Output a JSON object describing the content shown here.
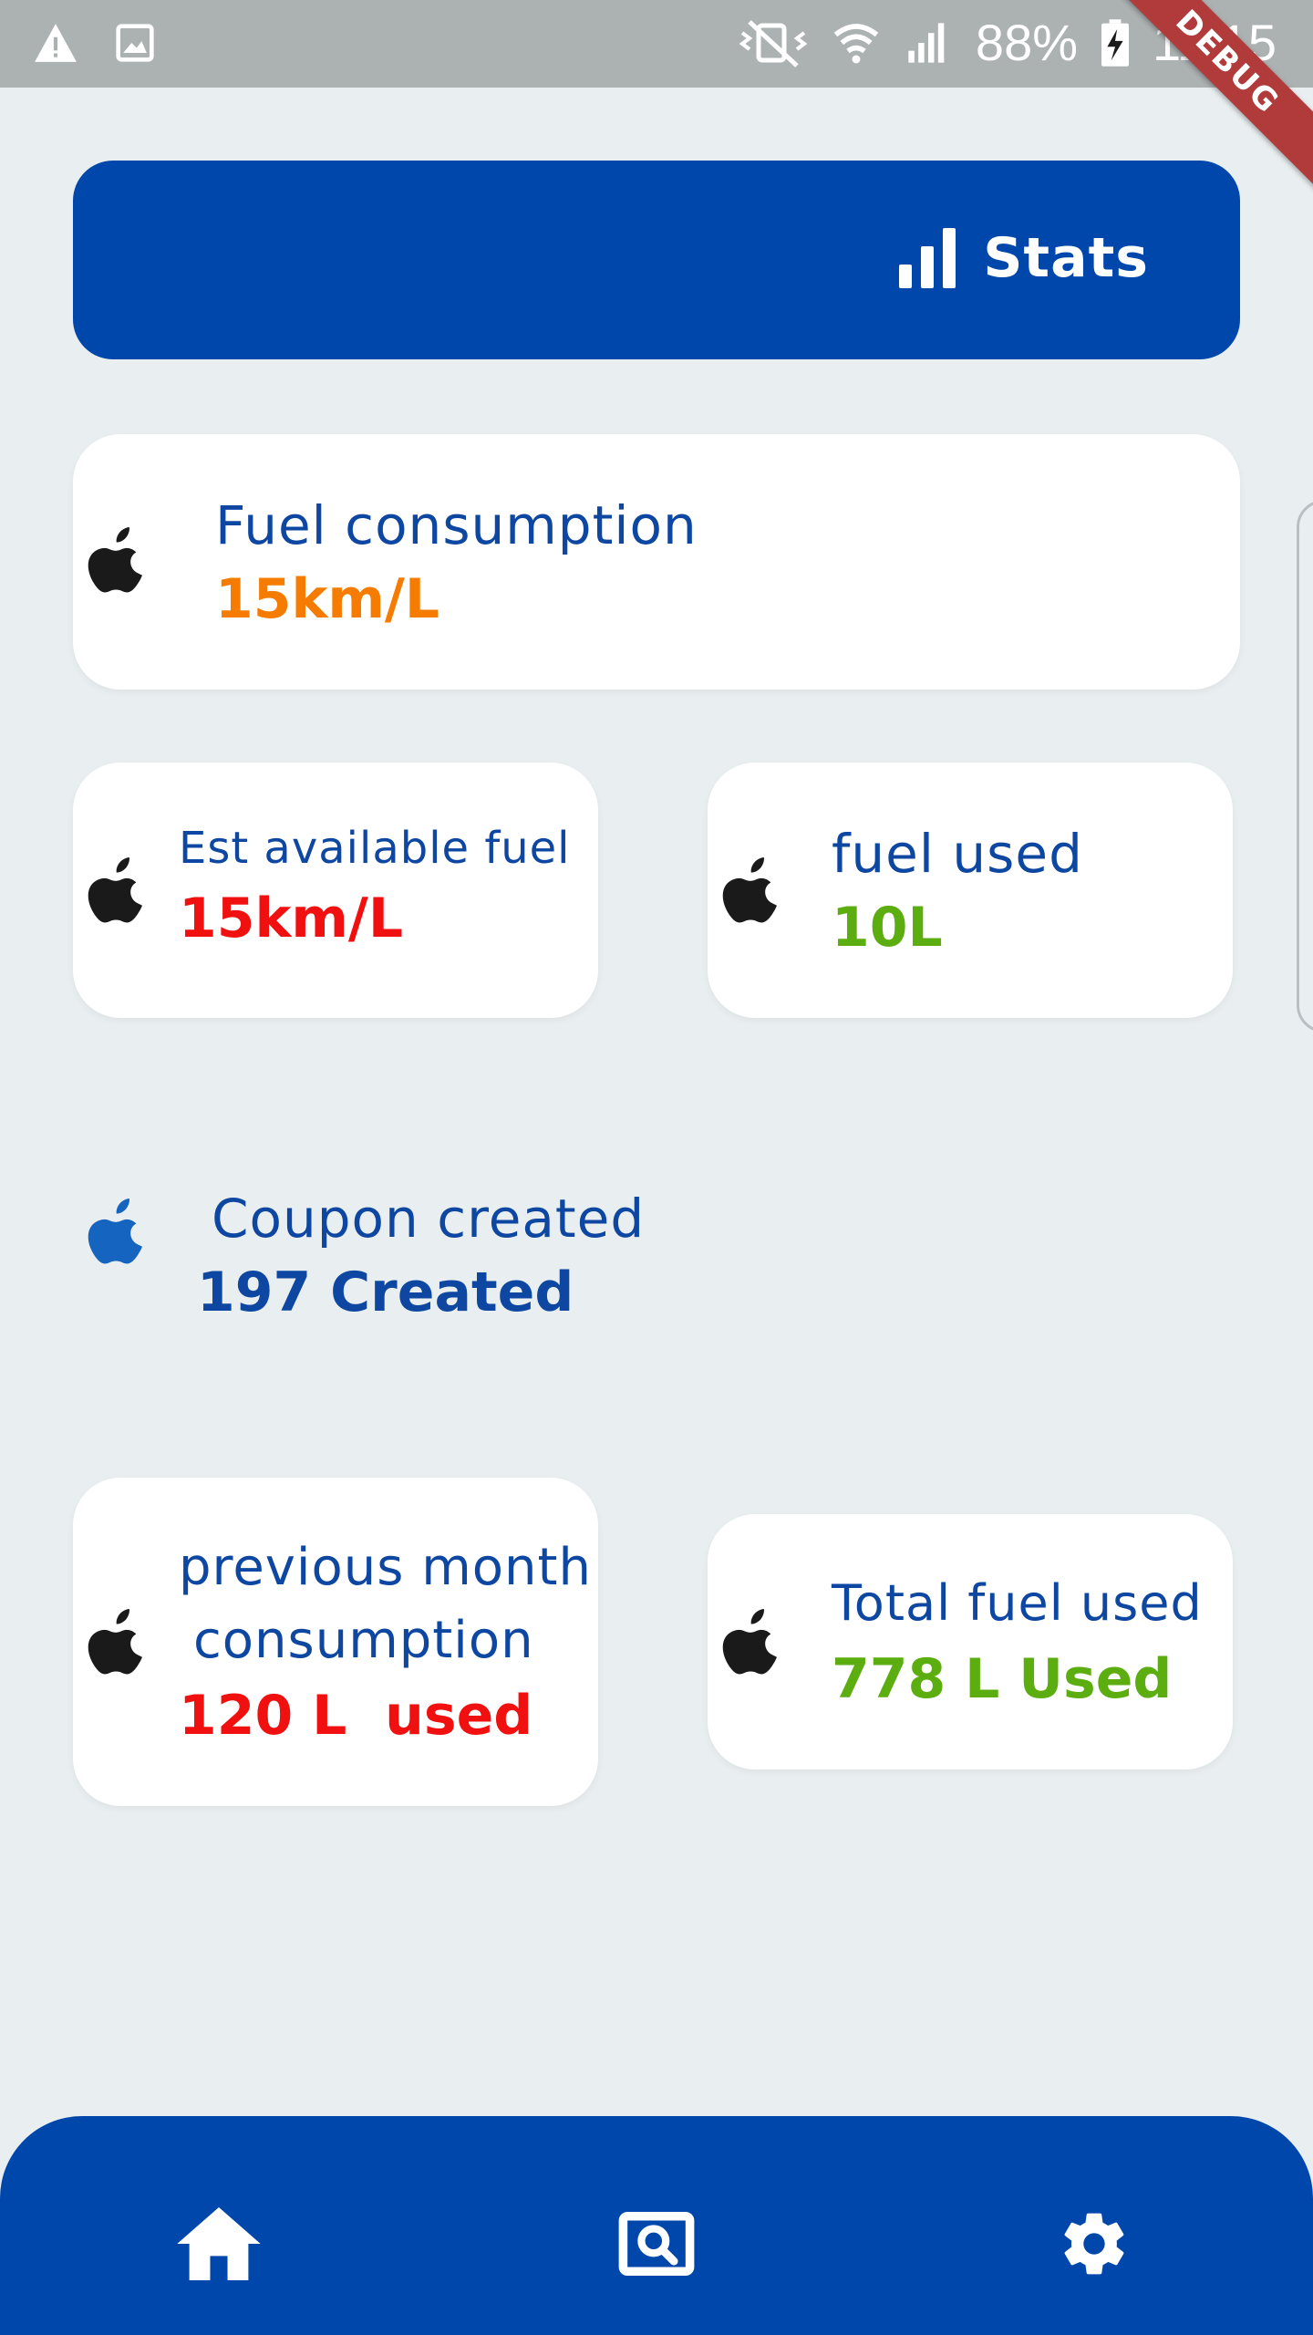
{
  "status_bar": {
    "battery": "88%",
    "time": "11:15",
    "icons": [
      "warning-icon",
      "image-icon",
      "vibrate-mute-icon",
      "wifi-icon",
      "signal-icon",
      "battery-charging-icon"
    ]
  },
  "debug_banner": "DEBUG",
  "header": {
    "icon": "bar-chart-icon",
    "title": "Stats"
  },
  "cards": {
    "fuel_consumption": {
      "label": "Fuel consumption",
      "value": "15km/L",
      "color": "#f57c00"
    },
    "est_available_fuel": {
      "label": "Est available fuel",
      "value": "15km/L",
      "color": "#f01010"
    },
    "fuel_used": {
      "label": "fuel used",
      "value": "10L",
      "color": "#5cae10"
    },
    "coupon_created": {
      "label": "Coupon created",
      "value": "197 Created",
      "color": "#0d47a1"
    },
    "previous_month": {
      "label_line1": "previous month",
      "label_line2": "consumption",
      "value": "120 L  used",
      "color": "#f01010"
    },
    "total_fuel_used": {
      "label": "Total fuel used",
      "value": "778 L Used",
      "color": "#5cae10"
    }
  },
  "bottom_nav": {
    "items": [
      {
        "icon": "home-icon"
      },
      {
        "icon": "search-screen-icon"
      },
      {
        "icon": "gear-icon"
      }
    ]
  },
  "colors": {
    "primary": "#0047ab",
    "background": "#e9eef0",
    "label": "#0d47a1"
  }
}
